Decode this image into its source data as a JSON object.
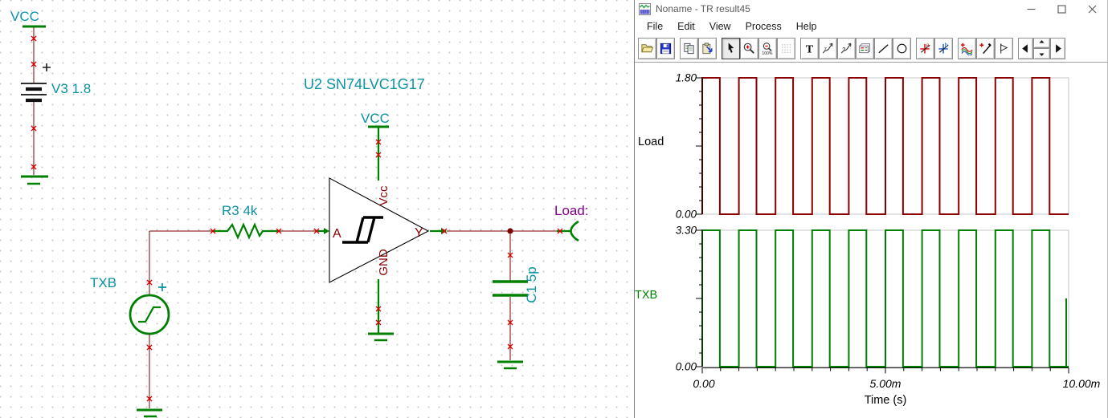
{
  "schematic": {
    "labels": {
      "vcc_top": "VCC",
      "v3": "V3 1.8",
      "txb": "TXB",
      "r3": "R3 4k",
      "u2": "U2 SN74LVC1G17",
      "u2_vcc": "VCC",
      "pin_a": "A",
      "pin_y": "Y",
      "pin_vcc": "Vcc",
      "pin_gnd": "GND",
      "c1": "C1 5p",
      "load": "Load:"
    },
    "colors": {
      "wire": "#7a0000",
      "component": "#008000",
      "label": "#0a93a5",
      "pin_label": "#8b0000",
      "net_label": "#80008b",
      "junction_x": "#d40000"
    }
  },
  "window": {
    "title": "Noname - TR result45",
    "icon": "waveform-app-icon",
    "controls": [
      "minimize",
      "maximize",
      "close"
    ],
    "menu": [
      "File",
      "Edit",
      "View",
      "Process",
      "Help"
    ],
    "toolbar": {
      "groups": [
        [
          "open",
          "save"
        ],
        [
          "copy",
          "paste"
        ],
        [
          "select",
          "zoom-in",
          "zoom-out-100",
          "grid"
        ],
        [
          "text",
          "axis-arrow",
          "axis-query",
          "legend",
          "line",
          "ellipse"
        ],
        [
          "cursor-a",
          "cursor-b"
        ],
        [
          "add-curves",
          "picker",
          "marker"
        ],
        [
          "nav-left",
          "nav-spinner",
          "nav-right"
        ]
      ],
      "pressed": "select",
      "disabled": [
        "grid"
      ]
    }
  },
  "chart_data": {
    "type": "line",
    "xlabel": "Time (s)",
    "x_unit": "ms",
    "x_range_ms": [
      0,
      10
    ],
    "xtick_labels": [
      "0.00",
      "5.00m",
      "10.00m"
    ],
    "xticks_ms": [
      0,
      5,
      10
    ],
    "grid": false,
    "panels": [
      {
        "name": "Load",
        "label_color": "#000000",
        "trace_color": "#8b0000",
        "waveform": "square",
        "ylim": [
          0,
          1.8
        ],
        "high_value": 1.8,
        "low_value": 0.0,
        "ytick_max_label": "1.80",
        "ytick_min_label": "0.00",
        "rise_times_ms": [
          0,
          1,
          2,
          3,
          4,
          5,
          6,
          7,
          8,
          9
        ],
        "fall_times_ms": [
          0.48,
          1.48,
          2.48,
          3.48,
          4.48,
          5.48,
          6.48,
          7.48,
          8.48,
          9.48
        ],
        "end_partial_rise": false
      },
      {
        "name": "TXB",
        "label_color": "#008000",
        "trace_color": "#008000",
        "waveform": "square",
        "ylim": [
          0,
          3.3
        ],
        "high_value": 3.3,
        "low_value": 0.0,
        "ytick_max_label": "3.30",
        "ytick_min_label": "0.00",
        "rise_times_ms": [
          0,
          1,
          2,
          3,
          4,
          5,
          6,
          7,
          8,
          9
        ],
        "fall_times_ms": [
          0.48,
          1.48,
          2.48,
          3.48,
          4.48,
          5.48,
          6.48,
          7.48,
          8.48,
          9.48
        ],
        "end_partial_rise": true
      }
    ]
  }
}
